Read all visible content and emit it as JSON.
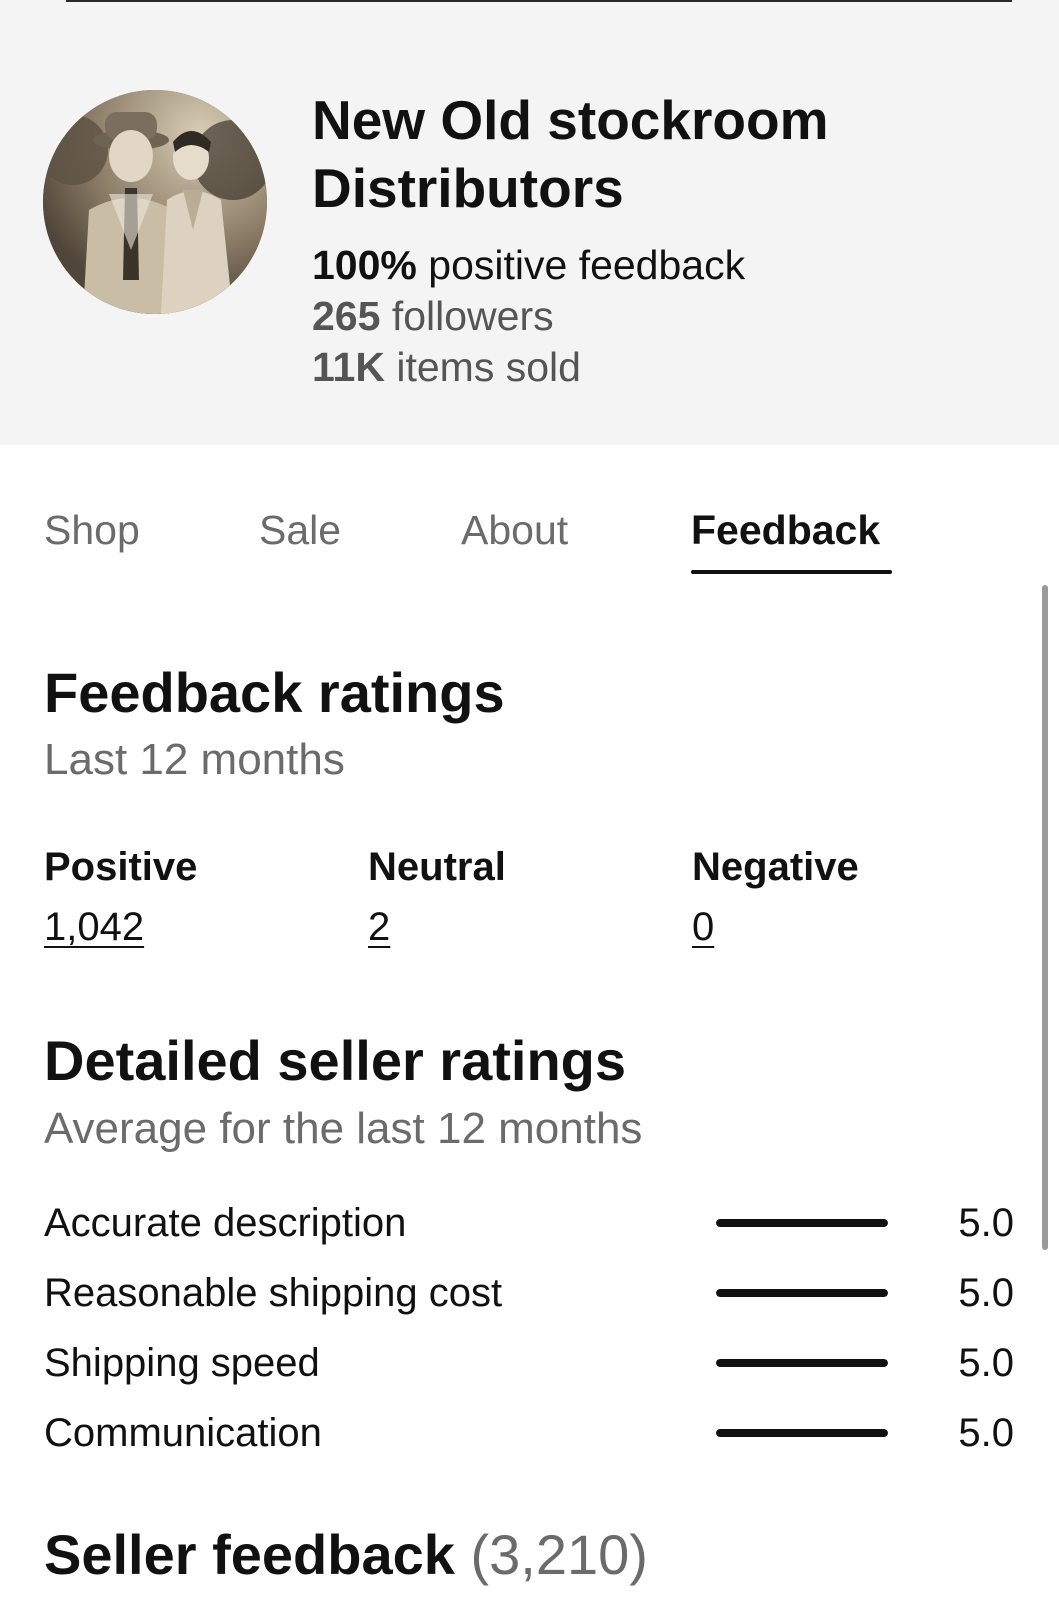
{
  "seller": {
    "name": "New Old stockroom Distributors",
    "stats": [
      {
        "value": "100%",
        "text": "positive feedback"
      },
      {
        "value": "265",
        "text": "followers"
      },
      {
        "value": "11K",
        "text": "items sold"
      }
    ]
  },
  "tabs": [
    {
      "label": "Shop",
      "active": false
    },
    {
      "label": "Sale",
      "active": false
    },
    {
      "label": "About",
      "active": false
    },
    {
      "label": "Feedback",
      "active": true
    }
  ],
  "feedback_ratings": {
    "title": "Feedback ratings",
    "subtitle": "Last 12 months",
    "columns": [
      {
        "label": "Positive",
        "count": "1,042"
      },
      {
        "label": "Neutral",
        "count": "2"
      },
      {
        "label": "Negative",
        "count": "0"
      }
    ]
  },
  "detailed_ratings": {
    "title": "Detailed seller ratings",
    "subtitle": "Average for the last 12 months",
    "max": 5.0,
    "rows": [
      {
        "label": "Accurate description",
        "value": "5.0",
        "score": 5.0
      },
      {
        "label": "Reasonable shipping cost",
        "value": "5.0",
        "score": 5.0
      },
      {
        "label": "Shipping speed",
        "value": "5.0",
        "score": 5.0
      },
      {
        "label": "Communication",
        "value": "5.0",
        "score": 5.0
      }
    ]
  },
  "seller_feedback": {
    "title": "Seller feedback",
    "count": "(3,210)"
  }
}
